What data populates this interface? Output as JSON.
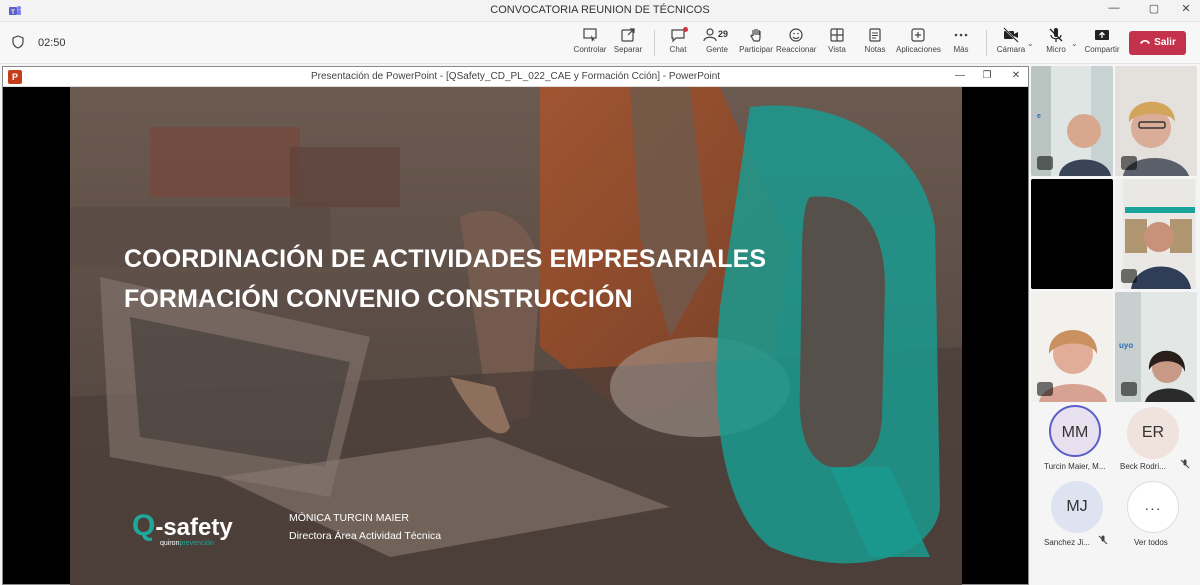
{
  "window": {
    "title": "CONVOCATORIA REUNION DE TÉCNICOS",
    "controls": [
      "—",
      "▢",
      "✕"
    ]
  },
  "toolbar": {
    "timer": "02:50",
    "buttons": [
      {
        "label": "Controlar",
        "icon": "control-icon"
      },
      {
        "label": "Separar",
        "icon": "popout-icon"
      },
      {
        "label": "Chat",
        "icon": "chat-icon"
      },
      {
        "label": "Gente",
        "icon": "people-icon"
      },
      {
        "label": "Participar",
        "icon": "raise-hand-icon"
      },
      {
        "label": "Reaccionar",
        "icon": "smiley-icon"
      },
      {
        "label": "Vista",
        "icon": "view-icon"
      },
      {
        "label": "Notas",
        "icon": "notes-icon"
      },
      {
        "label": "Aplicaciones",
        "icon": "apps-icon"
      },
      {
        "label": "Más",
        "icon": "more-icon"
      },
      {
        "label": "Cámara",
        "icon": "camera-off-icon"
      },
      {
        "label": "Micro",
        "icon": "mic-off-icon"
      },
      {
        "label": "Compartir",
        "icon": "share-icon"
      }
    ],
    "people_count": "29",
    "leave_label": "Salir",
    "leave_color": "#c4314b"
  },
  "ppt": {
    "window_title": "Presentación de PowerPoint - [QSafety_CD_PL_022_CAE y Formación Cción] - PowerPoint",
    "app_icon_letter": "P",
    "controls": [
      "—",
      "❐",
      "✕"
    ]
  },
  "slide": {
    "title_line1": "COORDINACIÓN DE ACTIVIDADES EMPRESARIALES",
    "title_line2": "FORMACIÓN CONVENIO CONSTRUCCIÓN",
    "presenter_name": "MÓNICA TURCIN MAIER",
    "presenter_role": "Directora Área Actividad Técnica",
    "logo_q": "Q",
    "logo_text": "-safety",
    "logo_sub_a": "quiron",
    "logo_sub_b": "prevención",
    "accent_color": "#1fa79a"
  },
  "participants": [
    {
      "initials": "MM",
      "name": "Turcin Maier, M...",
      "avatar_color": "#e8e0ee",
      "ring": "#5b5fc7"
    },
    {
      "initials": "ER",
      "name": "Beck Rodri...",
      "avatar_color": "#f0e2dc"
    },
    {
      "initials": "MJ",
      "name": "Sanchez Ji...",
      "avatar_color": "#dde3f0"
    },
    {
      "initials": "···",
      "name": "Ver todos",
      "avatar_color": "#ffffff"
    }
  ]
}
